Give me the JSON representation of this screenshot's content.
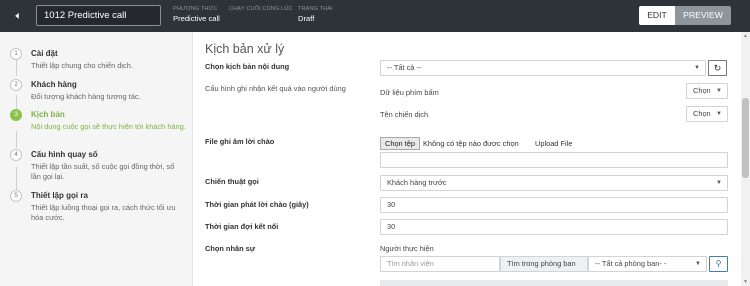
{
  "header": {
    "back_icon": "arrow-left-icon",
    "campaign_name": "1012 Predictive call",
    "meta": [
      {
        "label": "PHƯƠNG THỨC",
        "value": "Predictive call"
      },
      {
        "label": "CHẠY CUỐI CÙNG LÚC",
        "value": ""
      },
      {
        "label": "TRẠNG THÁI",
        "value": "Draff"
      }
    ],
    "edit_label": "EDIT",
    "preview_label": "PREVIEW"
  },
  "steps": [
    {
      "num": "1",
      "name": "Cài đặt",
      "desc": "Thiết lập chung cho chiến dịch."
    },
    {
      "num": "2",
      "name": "Khách hàng",
      "desc": "Đối tượng khách hàng tương tác."
    },
    {
      "num": "3",
      "name": "Kịch bản",
      "desc": "Nội dung cuộc gọi sẽ thực hiện tới khách hàng."
    },
    {
      "num": "4",
      "name": "Cấu hình quay số",
      "desc": "Thiết lập tần suất, số cuộc gọi đồng thời, số lần gọi lại."
    },
    {
      "num": "5",
      "name": "Thiết lập gọi ra",
      "desc": "Thiết lập luồng thoại gọi ra, cách thức tối ưu hóa cước."
    }
  ],
  "active_step": 3,
  "accent_color": "#8bc34a",
  "form": {
    "section_title": "Kịch bản xử lý",
    "script_label": "Chọn kịch bản nội dung",
    "script_value": "-- Tất cả --",
    "refresh_icon": "refresh-icon",
    "config_label": "Cấu hình ghi nhận kết quả vào người dùng",
    "keypress_label": "Dữ liệu phím bấm",
    "keypress_value": "Chọn",
    "campaign_name_label": "Tên chiến dịch",
    "campaign_name_value": "Chọn",
    "greeting_label": "File ghi âm lời chào",
    "choose_file_label": "Chọn tệp",
    "no_file_text": "Không có tệp nào được chọn",
    "upload_label": "Upload File",
    "greeting_path_value": "",
    "strategy_label": "Chiến thuật gọi",
    "strategy_value": "Khách hàng trước",
    "greeting_time_label": "Thời gian phát lời chào (giây)",
    "greeting_time_value": "30",
    "connect_wait_label": "Thời gian đợi kết nối",
    "connect_wait_value": "30",
    "staff_label": "Chọn nhân sự",
    "executor_label": "Người thực hiện",
    "search_staff_placeholder": "Tìm nhân viên",
    "dept_search_label": "Tìm trong phòng ban",
    "dept_value": "-- Tất cả phòng ban- -",
    "search_icon": "search-icon"
  }
}
